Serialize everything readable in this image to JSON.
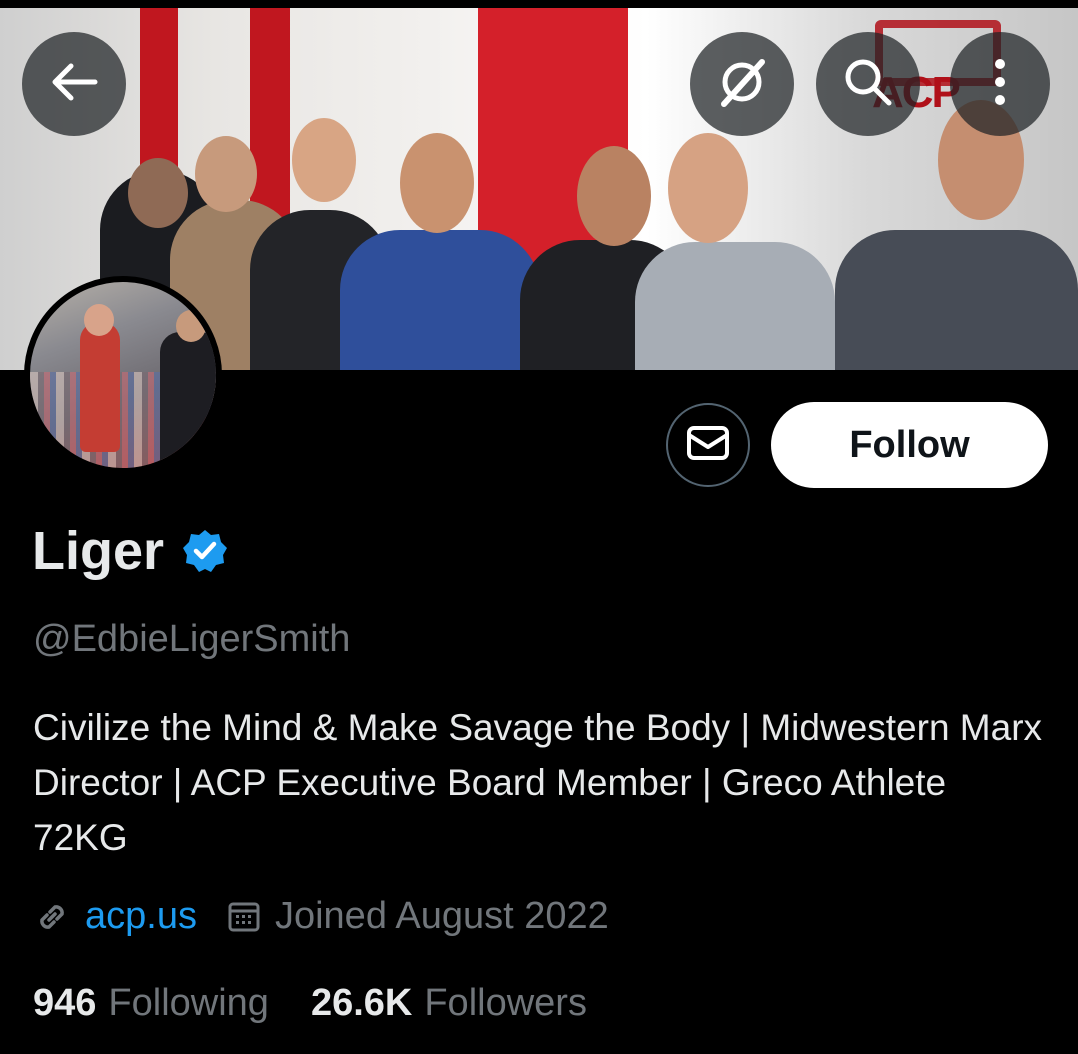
{
  "header": {
    "back_icon": "arrow-left-icon",
    "grok_icon": "grok-icon",
    "search_icon": "search-icon",
    "more_icon": "more-vertical-icon"
  },
  "banner": {
    "logo_text": "ACP"
  },
  "actions": {
    "message_icon": "mail-icon",
    "follow_label": "Follow"
  },
  "profile": {
    "name": "Liger",
    "verified_icon": "verified-badge-icon",
    "handle": "@EdbieLigerSmith",
    "bio": "Civilize the Mind & Make Savage the Body | Midwestern Marx Director | ACP Executive Board Member | Greco Athlete 72KG",
    "link_icon": "link-icon",
    "website": "acp.us",
    "calendar_icon": "calendar-icon",
    "joined": "Joined August 2022"
  },
  "stats": {
    "following_count": "946",
    "following_label": "Following",
    "followers_count": "26.6K",
    "followers_label": "Followers"
  },
  "colors": {
    "background": "#000000",
    "text_primary": "#e7e9ea",
    "text_secondary": "#71767b",
    "link": "#1d9bf0",
    "verified": "#1d9bf0",
    "follow_bg": "#ffffff"
  }
}
